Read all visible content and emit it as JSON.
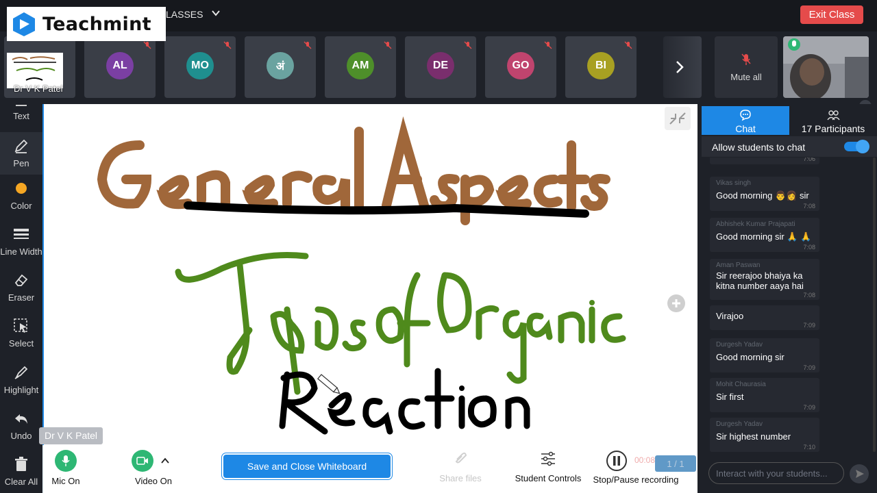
{
  "brand": {
    "name": "Teachmint"
  },
  "header": {
    "class_title": "LASSES",
    "exit_label": "Exit Class"
  },
  "participants_strip": {
    "host": {
      "name": "Dr V K Patel"
    },
    "tiles": [
      {
        "initials": "AL",
        "color": "#7b3fa3"
      },
      {
        "initials": "MO",
        "color": "#1f8f8f"
      },
      {
        "initials": "अं",
        "color": "#6aa3a0"
      },
      {
        "initials": "AM",
        "color": "#4e8f2a"
      },
      {
        "initials": "DE",
        "color": "#7a2e6d"
      },
      {
        "initials": "GO",
        "color": "#c0446e"
      },
      {
        "initials": "BI",
        "color": "#a8a022"
      }
    ],
    "mute_all_label": "Mute all"
  },
  "toolbar": {
    "items": [
      {
        "name": "text",
        "label": "Text"
      },
      {
        "name": "pen",
        "label": "Pen"
      },
      {
        "name": "color",
        "label": "Color"
      },
      {
        "name": "line-width",
        "label": "Line Width"
      },
      {
        "name": "eraser",
        "label": "Eraser"
      },
      {
        "name": "select",
        "label": "Select"
      },
      {
        "name": "highlight",
        "label": "Highlight"
      },
      {
        "name": "undo",
        "label": "Undo"
      },
      {
        "name": "clear-all",
        "label": "Clear All"
      }
    ]
  },
  "whiteboard": {
    "line1": "General Aspects",
    "line2": "Types of Organic",
    "line3": "Reaction",
    "presenter_label": "Dr V K Patel",
    "page": "1 / 1",
    "recording_time": "00:08"
  },
  "controls": {
    "mic_label": "Mic On",
    "video_label": "Video On",
    "save_label": "Save and Close Whiteboard",
    "share_label": "Share files",
    "student_controls_label": "Student Controls",
    "recording_label": "Stop/Pause recording"
  },
  "panel": {
    "chat_tab": "Chat",
    "participants_tab": "17 Participants",
    "allow_label": "Allow students to chat",
    "input_placeholder": "Interact with your students...",
    "messages": [
      {
        "sender": "",
        "text": "",
        "time": "7:06"
      },
      {
        "sender": "Vikas singh",
        "text": "Good morning 👨‍👩 sir",
        "time": "7:08"
      },
      {
        "sender": "Abhishek Kumar Prajapati",
        "text": "Good morning sir 🙏 🙏",
        "time": "7:08"
      },
      {
        "sender": "Aman Paswan",
        "text": "Sir reerajoo bhaiya ka kitna number aaya hai",
        "time": "7:08"
      },
      {
        "sender": "",
        "text": "Virajoo",
        "time": "7:09"
      },
      {
        "sender": "Durgesh Yadav",
        "text": "Good morning sir",
        "time": "7:09"
      },
      {
        "sender": "Mohit Chaurasia",
        "text": "Sir first",
        "time": "7:09"
      },
      {
        "sender": "Durgesh Yadav",
        "text": "Sir highest number",
        "time": "7:10"
      }
    ]
  },
  "colors": {
    "accent": "#1e88e5",
    "exit": "#e54b4b",
    "mic": "#2eb774",
    "ink_brown": "#a0673a",
    "ink_green": "#4f8a1c"
  }
}
